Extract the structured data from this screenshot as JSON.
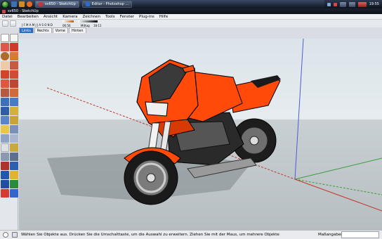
{
  "taskbar": {
    "tasks": [
      {
        "label": "sv650 - SketchUp",
        "active": true
      },
      {
        "label": "Editor - Photoshop ...",
        "active": false
      }
    ],
    "clock": "19:55"
  },
  "app": {
    "title": "sv650 - SketchUp",
    "menu": [
      "Datei",
      "Bearbeiten",
      "Ansicht",
      "Kamera",
      "Zeichnen",
      "Tools",
      "Fenster",
      "Plug-ins",
      "Hilfe"
    ],
    "shadows": {
      "months": "J F M A M J J A S O N D",
      "time_start": "06:56",
      "time_mid": "Mittag",
      "time_end": "18:11"
    },
    "scene_tabs": [
      {
        "label": "Links",
        "active": true
      },
      {
        "label": "Rechts",
        "active": false
      },
      {
        "label": "Vorne",
        "active": false
      },
      {
        "label": "Hinten",
        "active": false
      }
    ],
    "status": {
      "message": "Wählen Sie Objekte aus. Drücken Sie die Umschalttaste, um die Auswahl zu erweitern. Ziehen Sie mit der Maus, um mehrere Objekte",
      "measurements_label": "Maßangaben"
    },
    "colors": {
      "bike_orange": "#ff4a0a",
      "axis_red": "#c0392b",
      "axis_green": "#3a9e3a",
      "axis_blue": "#4a5fd0"
    }
  }
}
